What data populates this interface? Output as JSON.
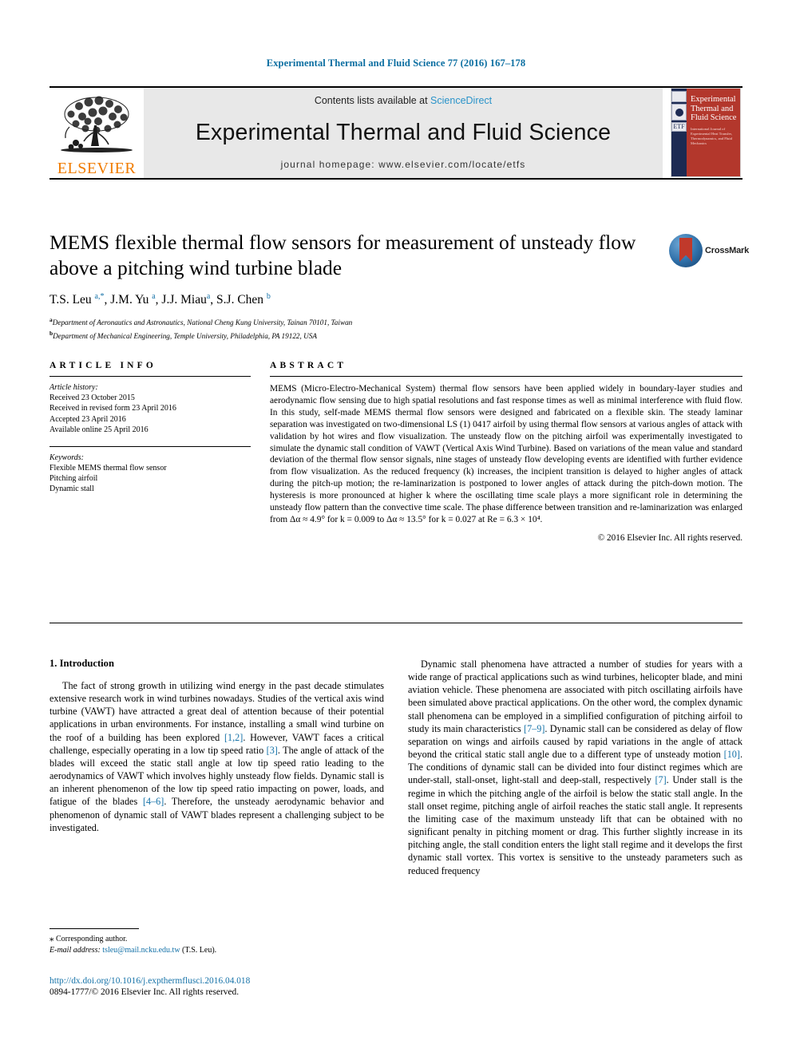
{
  "running_head": "Experimental Thermal and Fluid Science 77 (2016) 167–178",
  "banner": {
    "publisher_name": "ELSEVIER",
    "contents_prefix": "Contents lists available at ",
    "sciencedirect": "ScienceDirect",
    "journal_name": "Experimental Thermal and Fluid Science",
    "homepage": "journal homepage: www.elsevier.com/locate/etfs",
    "cover": {
      "logo_text": "ETF",
      "title": "Experimental Thermal and Fluid Science",
      "subtitle": "International Journal of Experimental Heat Transfer, Thermodynamics, and Fluid Mechanics"
    }
  },
  "article": {
    "title": "MEMS flexible thermal flow sensors for measurement of unsteady flow above a pitching wind turbine blade",
    "crossmark_label": "CrossMark",
    "authors_html": "T.S. Leu <sup>a,*</sup>, J.M. Yu <sup>a</sup>, J.J. Miau<sup>a</sup>, S.J. Chen <sup>b</sup>",
    "affiliations": [
      "Department of Aeronautics and Astronautics, National Cheng Kung University, Tainan 70101, Taiwan",
      "Department of Mechanical Engineering, Temple University, Philadelphia, PA 19122, USA"
    ],
    "affiliation_marks": [
      "a",
      "b"
    ]
  },
  "article_info": {
    "heading": "ARTICLE INFO",
    "history_label": "Article history:",
    "history": [
      "Received 23 October 2015",
      "Received in revised form 23 April 2016",
      "Accepted 23 April 2016",
      "Available online 25 April 2016"
    ],
    "keywords_label": "Keywords:",
    "keywords": [
      "Flexible MEMS thermal flow sensor",
      "Pitching airfoil",
      "Dynamic stall"
    ]
  },
  "abstract": {
    "heading": "ABSTRACT",
    "text": "MEMS (Micro-Electro-Mechanical System) thermal flow sensors have been applied widely in boundary-layer studies and aerodynamic flow sensing due to high spatial resolutions and fast response times as well as minimal interference with fluid flow. In this study, self-made MEMS thermal flow sensors were designed and fabricated on a flexible skin. The steady laminar separation was investigated on two-dimensional LS (1) 0417 airfoil by using thermal flow sensors at various angles of attack with validation by hot wires and flow visualization. The unsteady flow on the pitching airfoil was experimentally investigated to simulate the dynamic stall condition of VAWT (Vertical Axis Wind Turbine). Based on variations of the mean value and standard deviation of the thermal flow sensor signals, nine stages of unsteady flow developing events are identified with further evidence from flow visualization. As the reduced frequency (k) increases, the incipient transition is delayed to higher angles of attack during the pitch-up motion; the re-laminarization is postponed to lower angles of attack during the pitch-down motion. The hysteresis is more pronounced at higher k where the oscillating time scale plays a more significant role in determining the unsteady flow pattern than the convective time scale. The phase difference between transition and re-laminarization was enlarged from Δα ≈ 4.9° for k = 0.009 to Δα ≈ 13.5° for k = 0.027 at Re = 6.3 × 10⁴.",
    "copyright": "© 2016 Elsevier Inc. All rights reserved."
  },
  "body": {
    "section_heading": "1. Introduction",
    "left_paragraph_1_pre": "The fact of strong growth in utilizing wind energy in the past decade stimulates extensive research work in wind turbines nowadays. Studies of the vertical axis wind turbine (VAWT) have attracted a great deal of attention because of their potential applications in urban environments. For instance, installing a small wind turbine on the roof of a building has been explored ",
    "cite_1_2": "[1,2]",
    "left_paragraph_1_mid": ". However, VAWT faces a critical challenge, especially operating in a low tip speed ratio ",
    "cite_3": "[3]",
    "left_paragraph_1_mid2": ". The angle of attack of the blades will exceed the static stall angle at low tip speed ratio leading to the aerodynamics of VAWT which involves highly unsteady flow fields. Dynamic stall is an inherent phenomenon of the low tip speed ratio impacting on power, loads, and fatigue of the blades ",
    "cite_4_6": "[4–6]",
    "left_paragraph_1_end": ". Therefore, the unsteady aerodynamic behavior and phenomenon of dynamic stall of VAWT blades represent a challenging subject to be investigated.",
    "right_paragraph_pre": "Dynamic stall phenomena have attracted a number of studies for years with a wide range of practical applications such as wind turbines, helicopter blade, and mini aviation vehicle. These phenomena are associated with pitch oscillating airfoils have been simulated above practical applications. On the other word, the complex dynamic stall phenomena can be employed in a simplified configuration of pitching airfoil to study its main characteristics ",
    "cite_7_9": "[7–9]",
    "right_paragraph_mid": ". Dynamic stall can be considered as delay of flow separation on wings and airfoils caused by rapid variations in the angle of attack beyond the critical static stall angle due to a different type of unsteady motion ",
    "cite_10": "[10]",
    "right_paragraph_mid2": ". The conditions of dynamic stall can be divided into four distinct regimes which are under-stall, stall-onset, light-stall and deep-stall, respectively ",
    "cite_7": "[7]",
    "right_paragraph_end": ". Under stall is the regime in which the pitching angle of the airfoil is below the static stall angle. In the stall onset regime, pitching angle of airfoil reaches the static stall angle. It represents the limiting case of the maximum unsteady lift that can be obtained with no significant penalty in pitching moment or drag. This further slightly increase in its pitching angle, the stall condition enters the light stall regime and it develops the first dynamic stall vortex. This vortex is sensitive to the unsteady parameters such as reduced frequency"
  },
  "footnotes": {
    "corresponding_mark": "⁎",
    "corresponding_text": "Corresponding author.",
    "email_label": "E-mail address:",
    "email": "tsleu@mail.ncku.edu.tw",
    "email_owner": "(T.S. Leu)."
  },
  "footer": {
    "doi": "http://dx.doi.org/10.1016/j.expthermflusci.2016.04.018",
    "issn": "0894-1777/© 2016 Elsevier Inc. All rights reserved."
  },
  "colors": {
    "link": "#1572a8",
    "running_head": "#0a6ea1",
    "elsevier_orange": "#f07c00",
    "cover_red": "#b3372c",
    "cover_navy": "#1d2a52"
  }
}
